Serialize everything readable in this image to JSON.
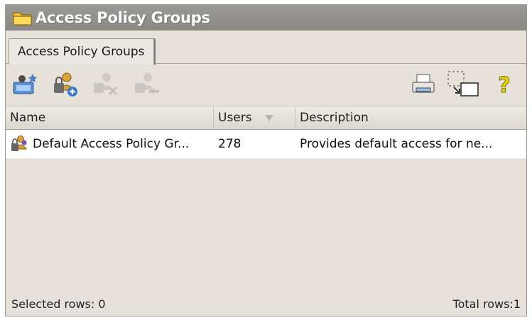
{
  "window": {
    "title": "Access Policy Groups",
    "title_icon": "folder-icon"
  },
  "tabs": [
    {
      "label": "Access Policy Groups",
      "active": true
    }
  ],
  "toolbar": {
    "left_buttons": [
      {
        "icon": "new-group-icon",
        "enabled": true
      },
      {
        "icon": "add-users-icon",
        "enabled": true
      },
      {
        "icon": "remove-users-icon",
        "enabled": false
      },
      {
        "icon": "delete-group-icon",
        "enabled": false
      }
    ],
    "right_buttons": [
      {
        "icon": "print-icon",
        "enabled": true
      },
      {
        "icon": "export-icon",
        "enabled": true
      },
      {
        "icon": "help-icon",
        "enabled": true
      }
    ]
  },
  "grid": {
    "columns": [
      {
        "label": "Name"
      },
      {
        "label": "Users",
        "sorted": "descending"
      },
      {
        "label": "Description"
      }
    ],
    "rows": [
      {
        "icon": "access-group-icon",
        "name": "Default Access Policy Gr...",
        "users": "278",
        "description": "Provides default access for ne..."
      }
    ]
  },
  "status": {
    "selected": "Selected rows: 0",
    "total": "Total rows:1"
  },
  "colors": {
    "titlebar": "#8f8d89",
    "panel": "#e6e2da",
    "help": "#e8d400"
  }
}
